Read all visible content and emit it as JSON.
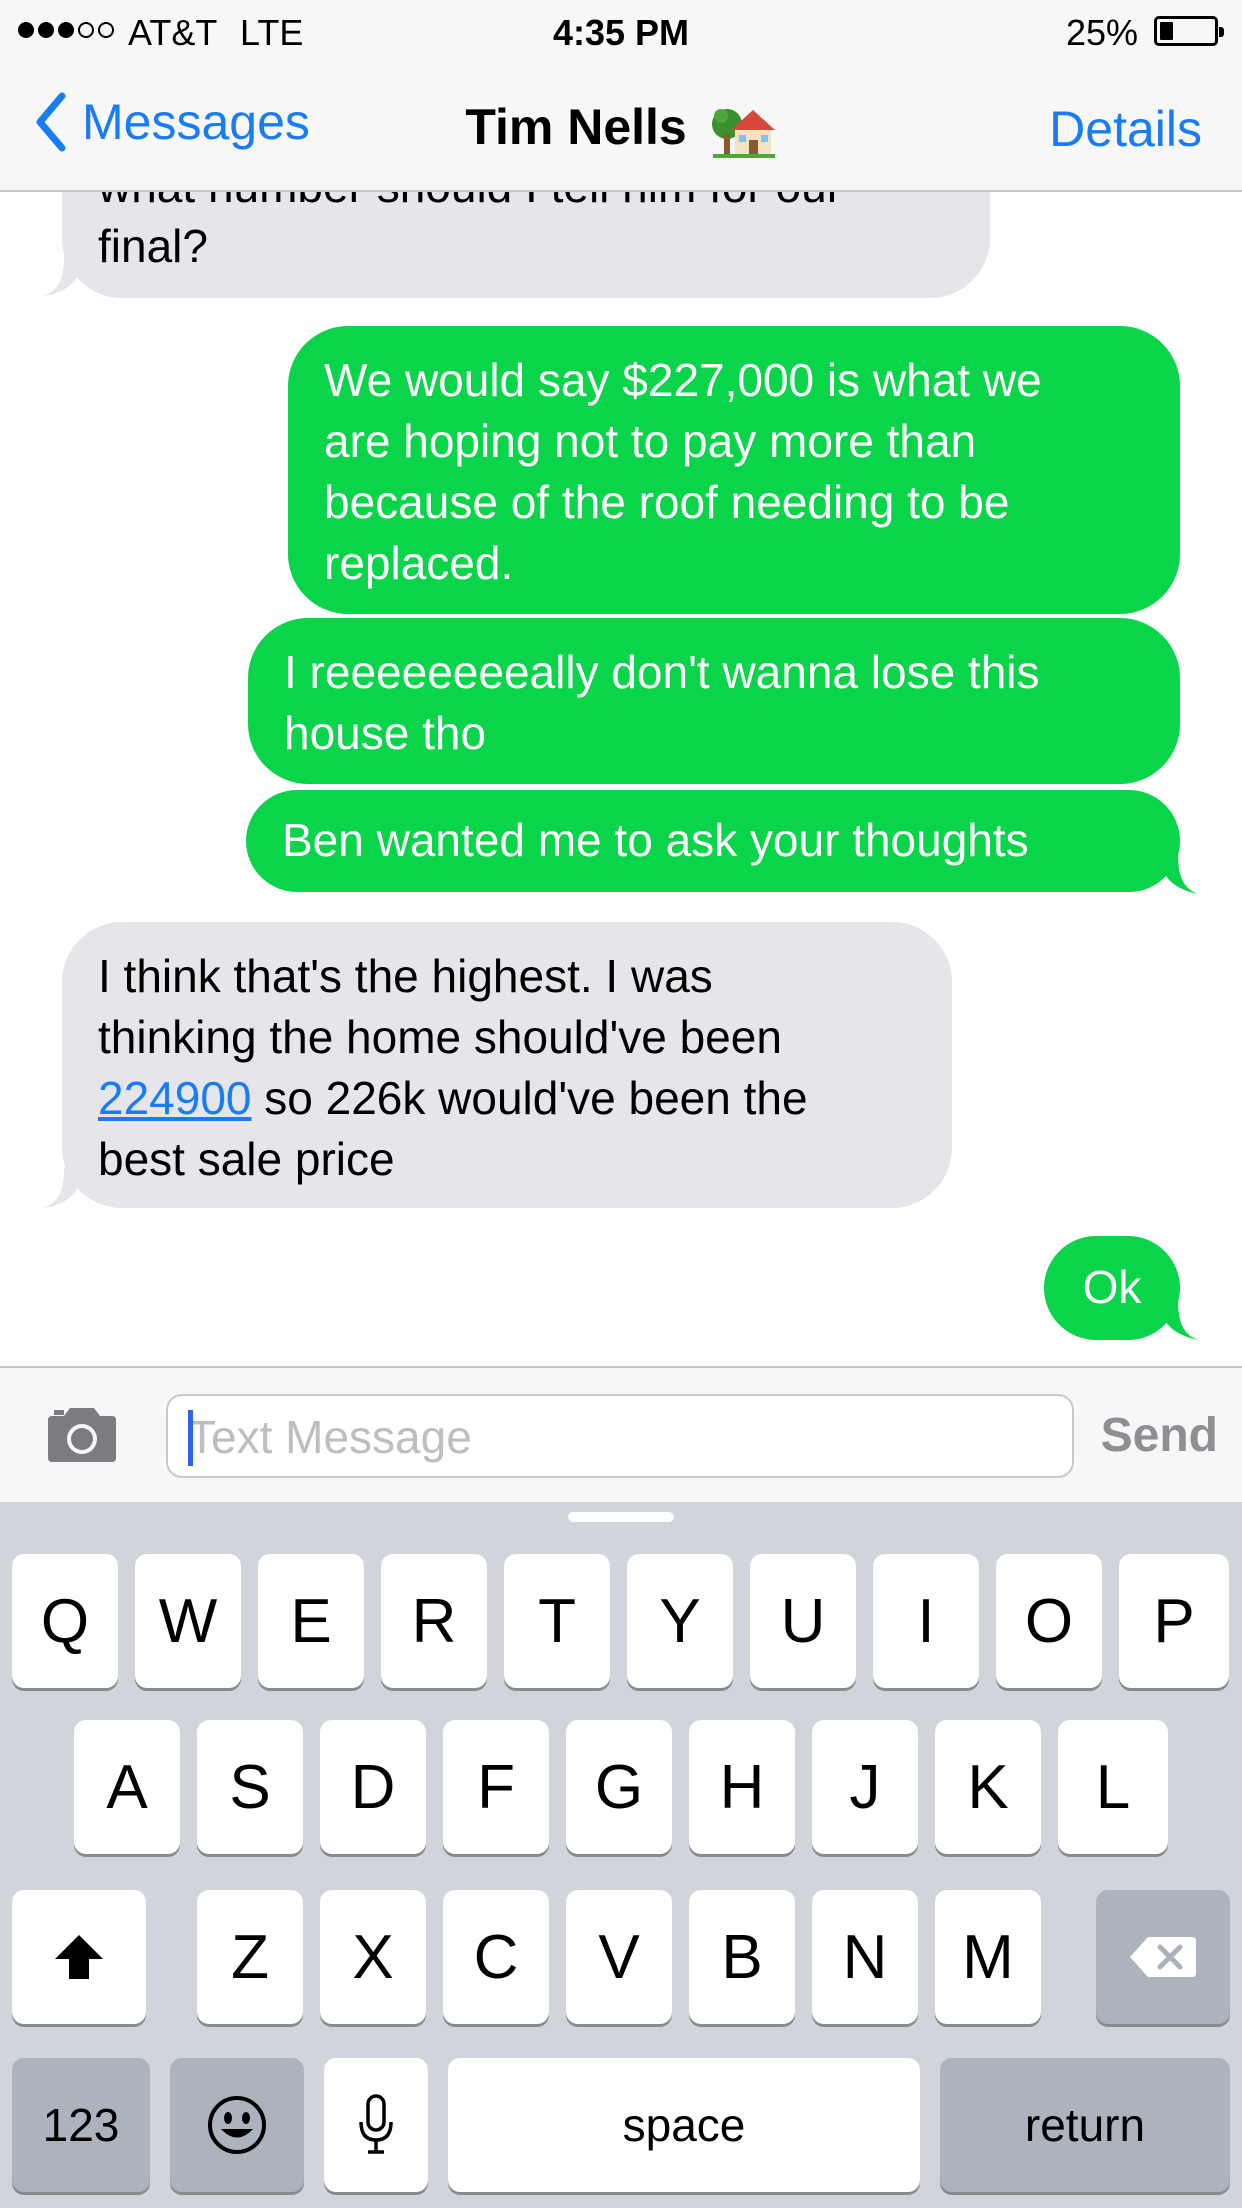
{
  "status_bar": {
    "carrier": "AT&T",
    "network": "LTE",
    "time": "4:35 PM",
    "battery_percent": "25%",
    "battery_level": 0.25,
    "signal_bars_filled": 3,
    "signal_bars_total": 5
  },
  "nav": {
    "back_label": "Messages",
    "title": "Tim Nells",
    "title_emoji": "house-with-garden-icon",
    "details_label": "Details"
  },
  "messages": [
    {
      "from": "them",
      "text_partial_top": "what number should I tell him for our",
      "text": "final?"
    },
    {
      "from": "me",
      "lines": [
        "We would say $227,000 is what we",
        "are hoping not to pay more than",
        "because of the roof needing to be",
        "replaced."
      ]
    },
    {
      "from": "me",
      "lines": [
        "I reeeeeeeeally don't wanna lose this",
        "house tho"
      ]
    },
    {
      "from": "me",
      "lines": [
        "Ben wanted me to ask your thoughts"
      ]
    },
    {
      "from": "them",
      "line1": "I think that's the highest. I was",
      "line2": "thinking the home should've been",
      "link": "224900",
      "line3_rest": " so 226k would've been the",
      "line4": "best sale price"
    },
    {
      "from": "me",
      "lines": [
        "Ok"
      ]
    }
  ],
  "composer": {
    "placeholder": "Text Message",
    "value": "",
    "send_label": "Send",
    "camera_icon": "camera-icon"
  },
  "keyboard": {
    "row1": [
      "Q",
      "W",
      "E",
      "R",
      "T",
      "Y",
      "U",
      "I",
      "O",
      "P"
    ],
    "row2": [
      "A",
      "S",
      "D",
      "F",
      "G",
      "H",
      "J",
      "K",
      "L"
    ],
    "row3": [
      "Z",
      "X",
      "C",
      "V",
      "B",
      "N",
      "M"
    ],
    "numbers_label": "123",
    "space_label": "space",
    "return_label": "return",
    "shift_icon": "shift-icon",
    "delete_icon": "delete-icon",
    "emoji_icon": "emoji-icon",
    "mic_icon": "microphone-icon"
  },
  "colors": {
    "accent": "#1a7cf5",
    "sent_bubble": "#0ad449",
    "received_bubble": "#e5e5ea",
    "keyboard_bg": "#d1d5db"
  }
}
